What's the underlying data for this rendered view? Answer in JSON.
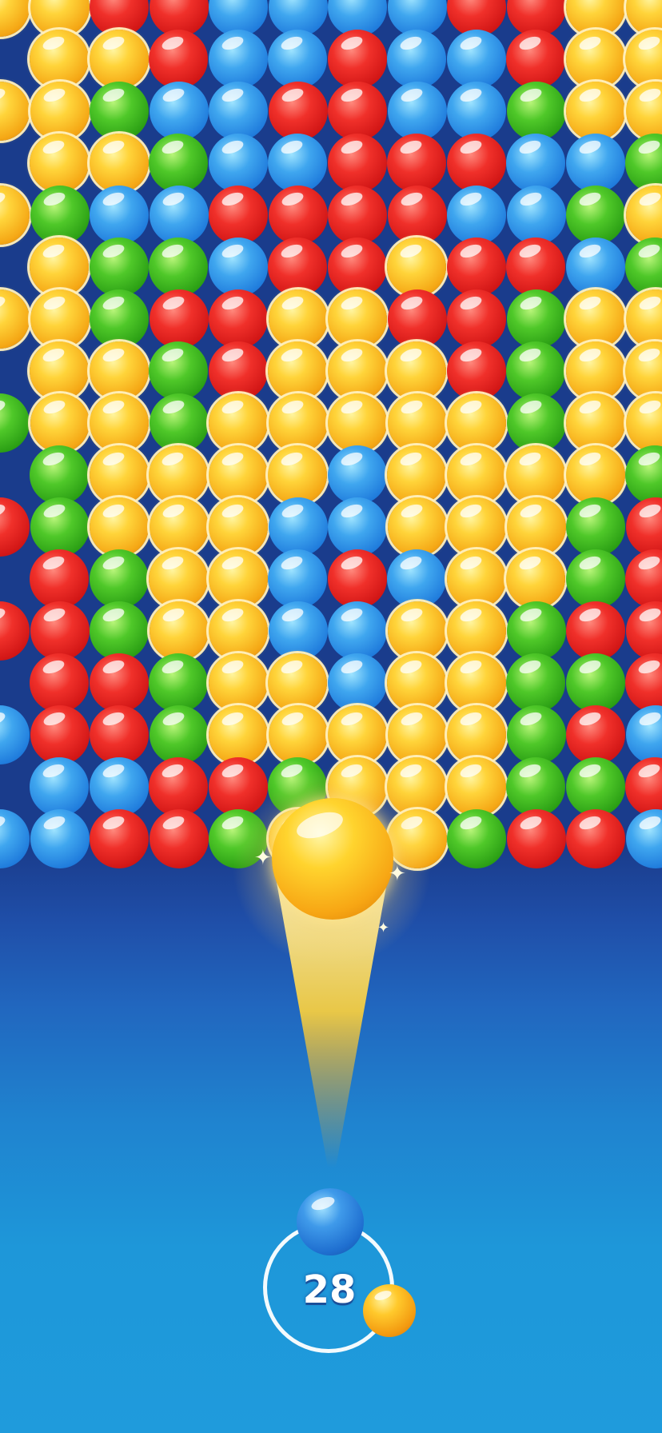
{
  "game": {
    "shots_left": "28",
    "current_bubble_color": "blue",
    "next_bubble_color": "yellow",
    "fired_bubble_color": "yellow"
  },
  "palette": {
    "y": "#ffd43a",
    "r": "#e02020",
    "b": "#2f8fe6",
    "g": "#3fb81e"
  },
  "board": {
    "rows": [
      "yyrrbbbbrryy",
      "yyrbbrbbryy",
      "yygbbrrbbgyy",
      "yygbbrrrbbgy",
      "ygbbrrrrbbgy",
      "yggbrryrrbgy",
      "yygrryyrrgyy",
      "yygryyyrgyy",
      "gyygyyyyygyy",
      "gyyyybyyyygg",
      "rgyyybbyyygr",
      "rgyybrbyygrr",
      "rrgyybbyygrr",
      "rrgyybyyggrr",
      "brrgyyyyygrb",
      "bbrrgyyyggrb",
      "bbrrgy_ygrrbb"
    ]
  }
}
